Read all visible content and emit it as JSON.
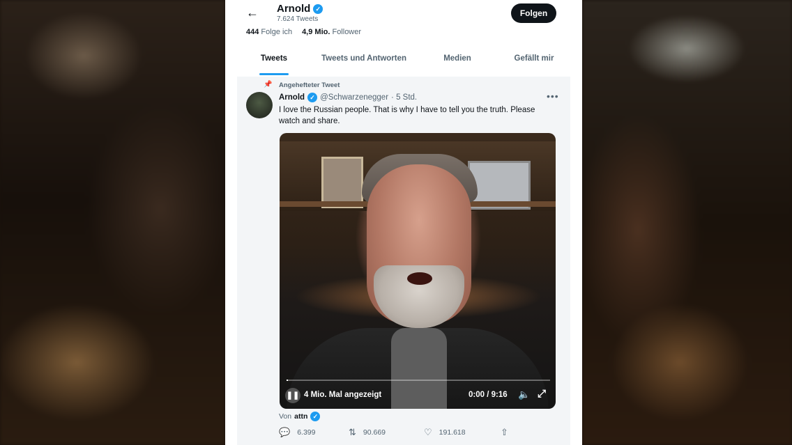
{
  "profile": {
    "back_icon": "arrow-left-icon",
    "name": "Arnold",
    "tweet_count": "7.624 Tweets",
    "follow_label": "Folgen",
    "following_count": "444",
    "following_label": "Folge ich",
    "followers_count": "4,9 Mio.",
    "followers_label": "Follower"
  },
  "tabs": [
    {
      "label": "Tweets",
      "active": true
    },
    {
      "label": "Tweets und Antworten",
      "active": false
    },
    {
      "label": "Medien",
      "active": false
    },
    {
      "label": "Gefällt mir",
      "active": false
    }
  ],
  "tweet": {
    "pinned_label": "Angehefteter Tweet",
    "author": "Arnold",
    "handle": "@Schwarzenegger",
    "time": "· 5 Std.",
    "more_label": "•••",
    "text": "I love the Russian people. That is why I have to tell you the truth. Please watch and share.",
    "video": {
      "views": "4 Mio. Mal angezeigt",
      "time": "0:00 / 9:16",
      "progress": 0.005
    },
    "source_prefix": "Von",
    "source_name": "attn",
    "replies": "6.399",
    "retweets": "90.669",
    "likes": "191.618"
  },
  "colors": {
    "accent": "#1d9bf0",
    "text_primary": "#0f1419",
    "text_secondary": "#536471",
    "button_dark": "#0f1419"
  }
}
